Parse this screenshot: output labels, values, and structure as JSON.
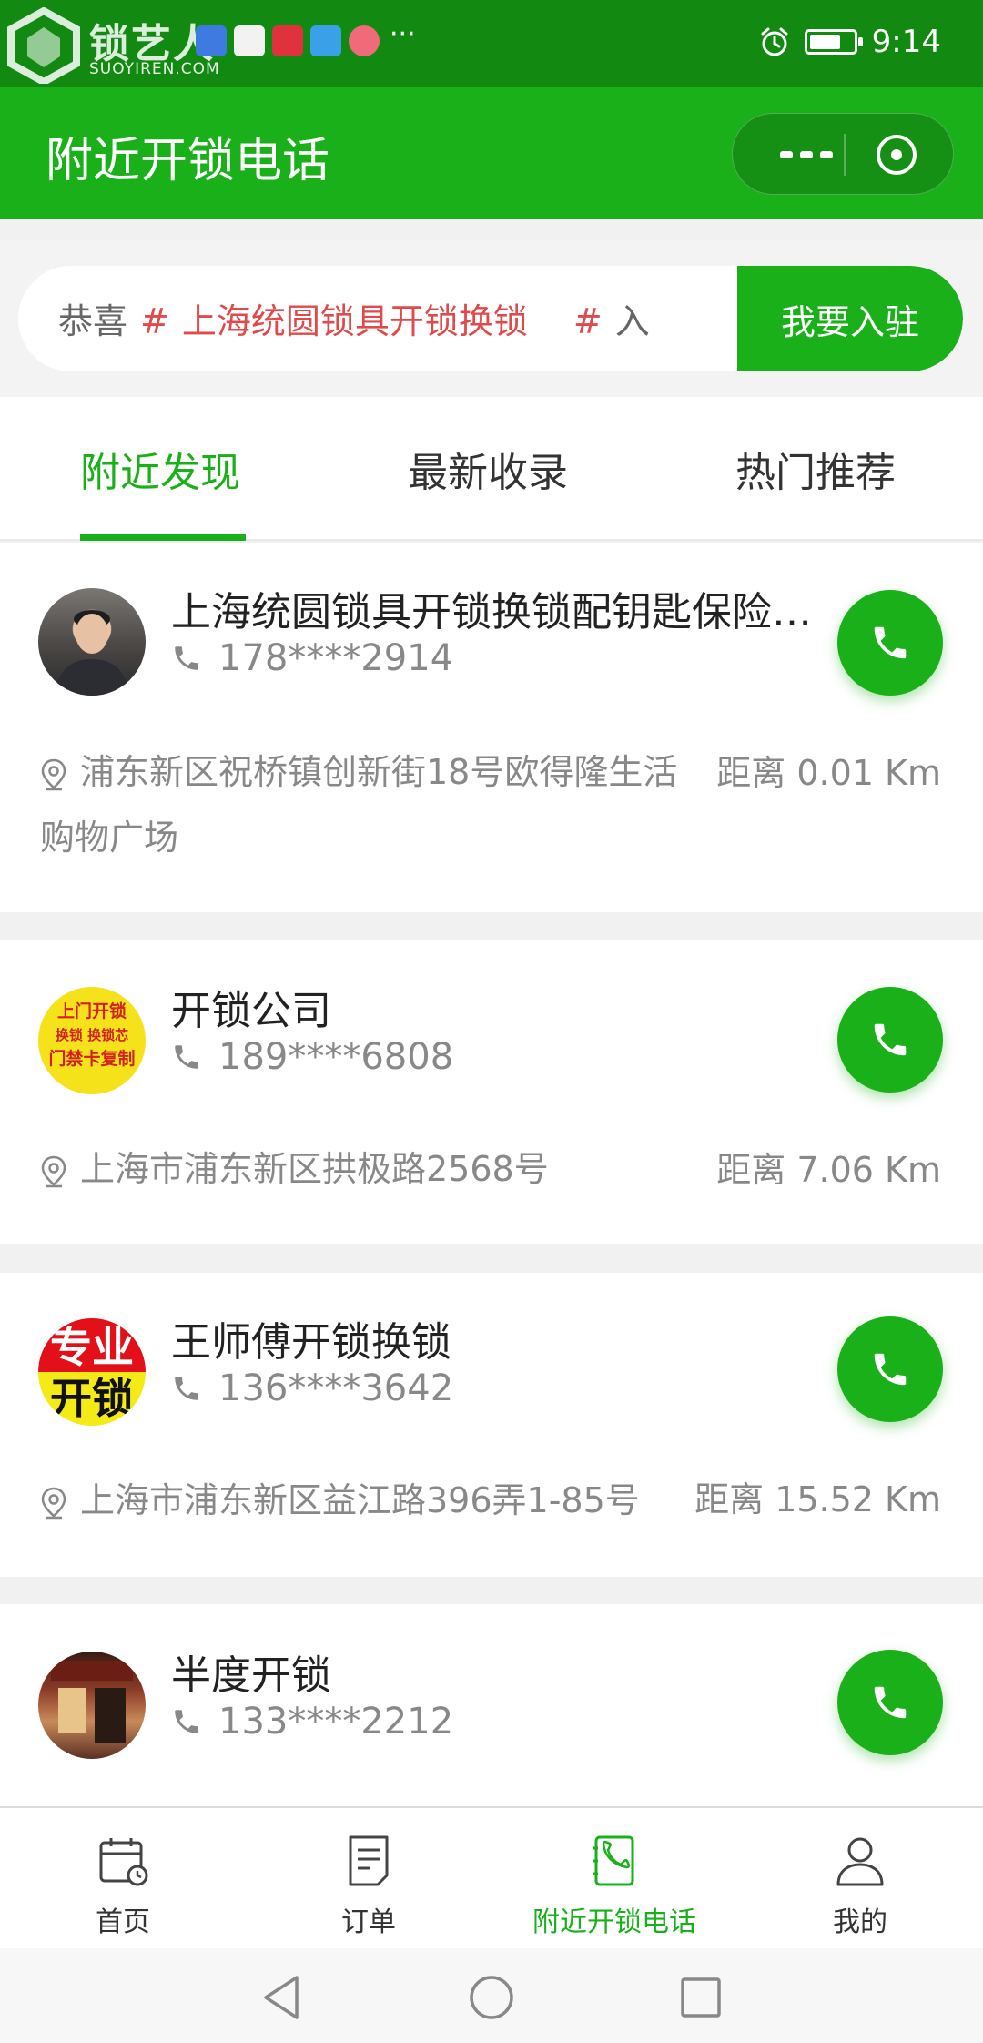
{
  "status_bar": {
    "watermark": "锁艺人",
    "watermark_sub": "SUOYIREN.COM",
    "more": "···",
    "time": "9:14",
    "battery_level": 0.75
  },
  "header": {
    "title": "附近开锁电话"
  },
  "announcement": {
    "prefix": "恭喜",
    "hash": "#",
    "shop": "上海统圆锁具开锁换锁",
    "suffix": "入",
    "button": "我要入驻"
  },
  "tabs": [
    {
      "label": "附近发现",
      "active": true
    },
    {
      "label": "最新收录",
      "active": false
    },
    {
      "label": "热门推荐",
      "active": false
    }
  ],
  "listings": [
    {
      "name": "上海统圆锁具开锁换锁配钥匙保险…",
      "phone": "178****2914",
      "address": "浦东新区祝桥镇创新街18号欧得隆生活购物广场",
      "distance": "距离 0.01 Km"
    },
    {
      "name": "开锁公司",
      "phone": "189****6808",
      "address": "上海市浦东新区拱极路2568号",
      "distance": "距离 7.06 Km",
      "avatar_text": [
        "上门开锁",
        "换锁 换锁芯",
        "门禁卡复制"
      ]
    },
    {
      "name": "王师傅开锁换锁",
      "phone": "136****3642",
      "address": "上海市浦东新区益江路396弄1-85号",
      "distance": "距离 15.52 Km",
      "avatar_text": [
        "专业",
        "开锁"
      ]
    },
    {
      "name": "半度开锁",
      "phone": "133****2212"
    }
  ],
  "bottom_nav": [
    {
      "label": "首页",
      "icon": "calendar-clock-icon"
    },
    {
      "label": "订单",
      "icon": "document-icon"
    },
    {
      "label": "附近开锁电话",
      "icon": "phone-book-icon",
      "active": true
    },
    {
      "label": "我的",
      "icon": "user-icon"
    }
  ],
  "colors": {
    "brand_green": "#1ab01a",
    "status_green": "#128a12",
    "highlight_red": "#e04a4a"
  }
}
